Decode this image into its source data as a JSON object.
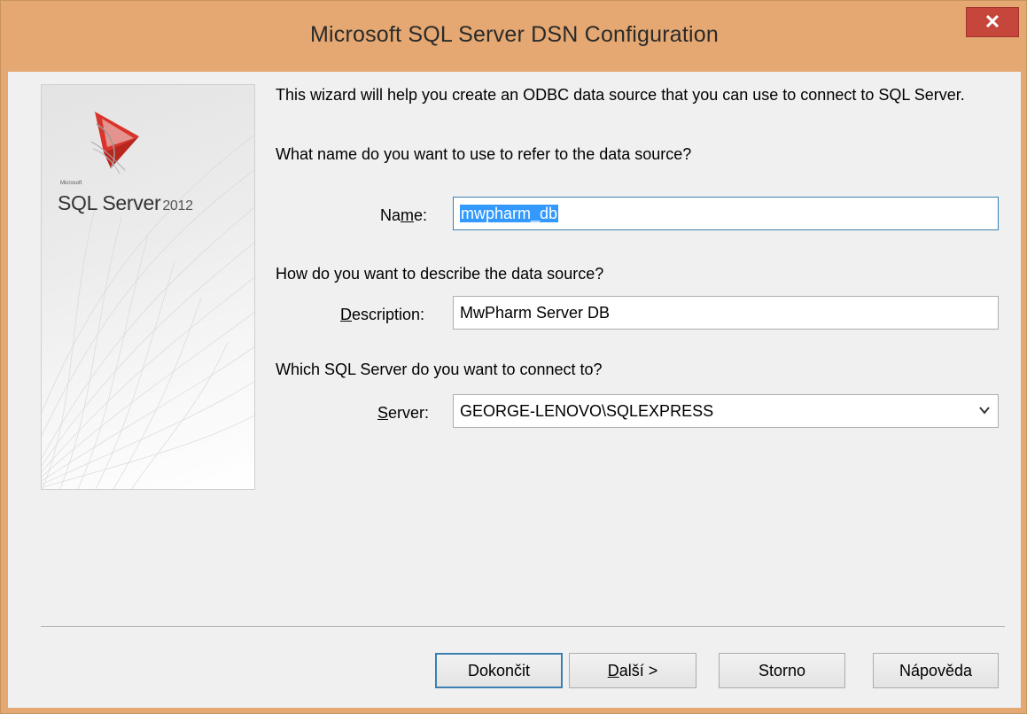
{
  "window": {
    "title": "Microsoft SQL Server DSN Configuration",
    "close_glyph": "✕"
  },
  "logo": {
    "icon": "sql-server-logo-icon",
    "microsoft": "Microsoft",
    "product": "SQL Server",
    "year": "2012"
  },
  "intro_text": "This wizard will help you create an ODBC data source that you can use to connect to SQL Server.",
  "name_section": {
    "question": "What name do you want to use to refer to the data source?",
    "label_pre": "Na",
    "label_mnemonic": "m",
    "label_post": "e:",
    "value": "mwpharm_db"
  },
  "description_section": {
    "question": "How do you want to describe the data source?",
    "label_mnemonic": "D",
    "label_post": "escription:",
    "value": "MwPharm Server DB"
  },
  "server_section": {
    "question": "Which SQL Server do you want to connect to?",
    "label_mnemonic": "S",
    "label_post": "erver:",
    "value": "GEORGE-LENOVO\\SQLEXPRESS",
    "arrow_icon": "chevron-down-icon"
  },
  "buttons": {
    "finish": "Dokončit",
    "next_mnemonic": "D",
    "next_post": "alší >",
    "cancel": "Storno",
    "help": "Nápověda"
  },
  "colors": {
    "frame": "#e5a872",
    "close": "#c7463c",
    "selection": "#3399ff",
    "focus": "#3c7fb1"
  }
}
